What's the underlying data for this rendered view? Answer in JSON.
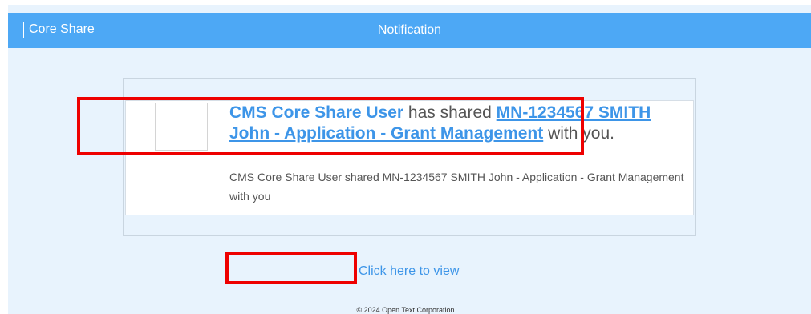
{
  "header": {
    "brand": "Core Share",
    "title": "Notification"
  },
  "notification": {
    "actor": "CMS Core Share User",
    "verb": "has shared",
    "document": "MN-1234567 SMITH John - Application - Grant Management",
    "suffix": "with you.",
    "description": "CMS Core Share User shared MN-1234567 SMITH John - Application - Grant Management with you"
  },
  "view": {
    "link_label": "Click here",
    "suffix": "to view"
  },
  "footer": {
    "copyright": "© 2024 Open Text Corporation"
  },
  "colors": {
    "header_bg": "#4da8f5",
    "page_bg": "#e8f3fd",
    "link": "#3d95e8",
    "annotation": "#ee0000"
  }
}
